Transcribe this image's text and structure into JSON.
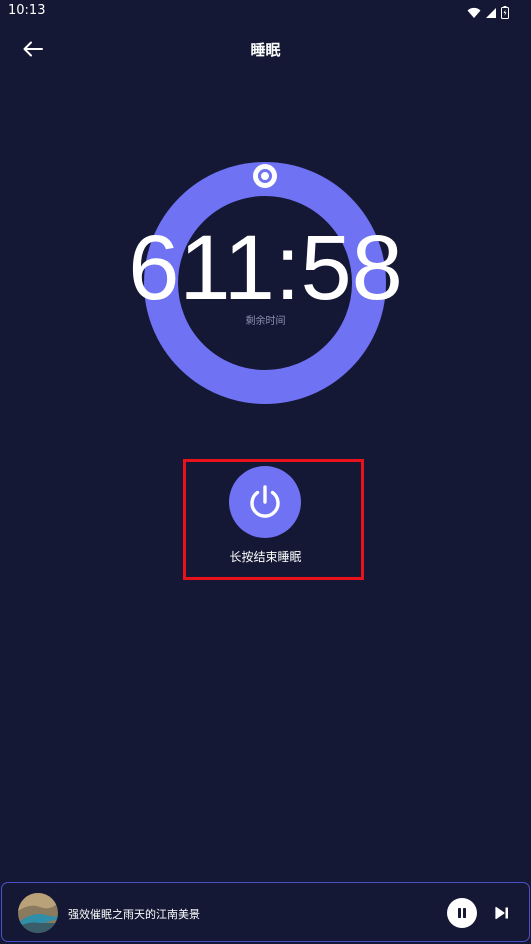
{
  "status_bar": {
    "time": "10:13",
    "icons": [
      "wifi-icon",
      "signal-icon",
      "battery-icon"
    ]
  },
  "header": {
    "title": "睡眠",
    "back_icon": "arrow-left-icon"
  },
  "timer": {
    "value": "611:58",
    "caption": "剩余时间",
    "ring_color": "#6f72f2",
    "knob_color": "#ffffff"
  },
  "power": {
    "label": "长按结束睡眠",
    "icon": "power-icon",
    "button_color": "#6f72f2",
    "highlight_color": "#e8121d"
  },
  "player": {
    "track_title": "强效催眠之雨天的江南美景",
    "pause_icon": "pause-icon",
    "next_icon": "skip-next-icon",
    "border_color": "#4d51c8"
  },
  "colors": {
    "background": "#141834",
    "accent": "#6f72f2",
    "muted_text": "#8e92b4"
  }
}
